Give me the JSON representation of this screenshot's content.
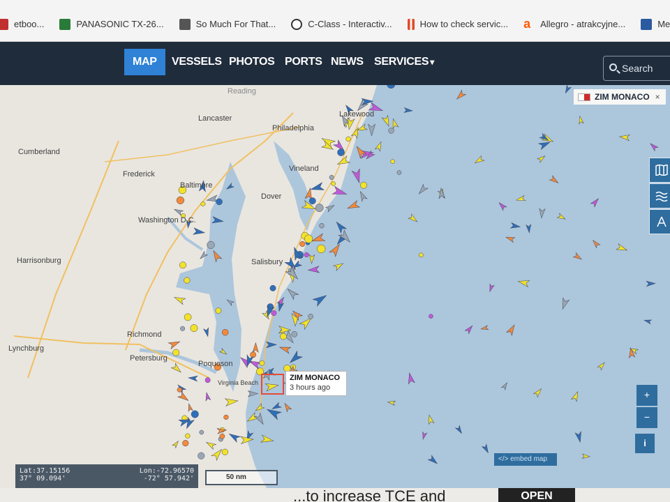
{
  "bookmarks": [
    {
      "label": "etboo...",
      "color": "#c03030"
    },
    {
      "label": "PANASONIC TX-26...",
      "color": "#2a7a3a"
    },
    {
      "label": "So Much For That...",
      "color": "#555555"
    },
    {
      "label": "C-Class - Interactiv...",
      "color": "#333333"
    },
    {
      "label": "How to check servic...",
      "color": "#e04a2a"
    },
    {
      "label": "Allegro - atrakcyjne...",
      "color": "#ff5a00"
    },
    {
      "label": "Mercedes Benz",
      "color": "#2a5aa0"
    }
  ],
  "nav": {
    "items": [
      "MAP",
      "VESSELS",
      "PHOTOS",
      "PORTS",
      "NEWS",
      "SERVICES"
    ],
    "services_caret": "▾",
    "search_placeholder": "Search Ships"
  },
  "map": {
    "cities": [
      "Reading",
      "Lancaster",
      "Lakewood",
      "Philadelphia",
      "Cumberland",
      "Frederick",
      "Vineland",
      "Baltimore",
      "Dover",
      "Washington D.C.",
      "Harrisonburg",
      "Salisbury",
      "Richmond",
      "Lynchburg",
      "Petersburg",
      "Poquoson",
      "Virginia Beach"
    ],
    "selected_vessel": {
      "name": "ZIM MONACO",
      "last_seen": "3 hours ago",
      "tab_close": "×"
    },
    "coordinates": {
      "lat_label": "Lat:",
      "lat_decimal": "37.15156",
      "lat_dms": "37° 09.094'",
      "lon_label": "Lon:",
      "lon_decimal": "-72.96570",
      "lon_dms": "-72° 57.942'"
    },
    "scale_label": "50 nm",
    "zoom_in": "+",
    "zoom_out": "−",
    "info": "i",
    "embed_label": "</> embed map"
  },
  "promo": {
    "text": "...to increase TCE and",
    "button": "OPEN"
  },
  "colors": {
    "nav_bg": "#1f2c3c",
    "nav_active": "#2f82d6",
    "sea": "#acc6dc",
    "land": "#e9e6e0",
    "cargo": "#f2e22a",
    "tanker": "#2f6fb8",
    "passenger": "#c05ad8",
    "fishing": "#f28a3a",
    "unknown": "#9aa8b4"
  }
}
